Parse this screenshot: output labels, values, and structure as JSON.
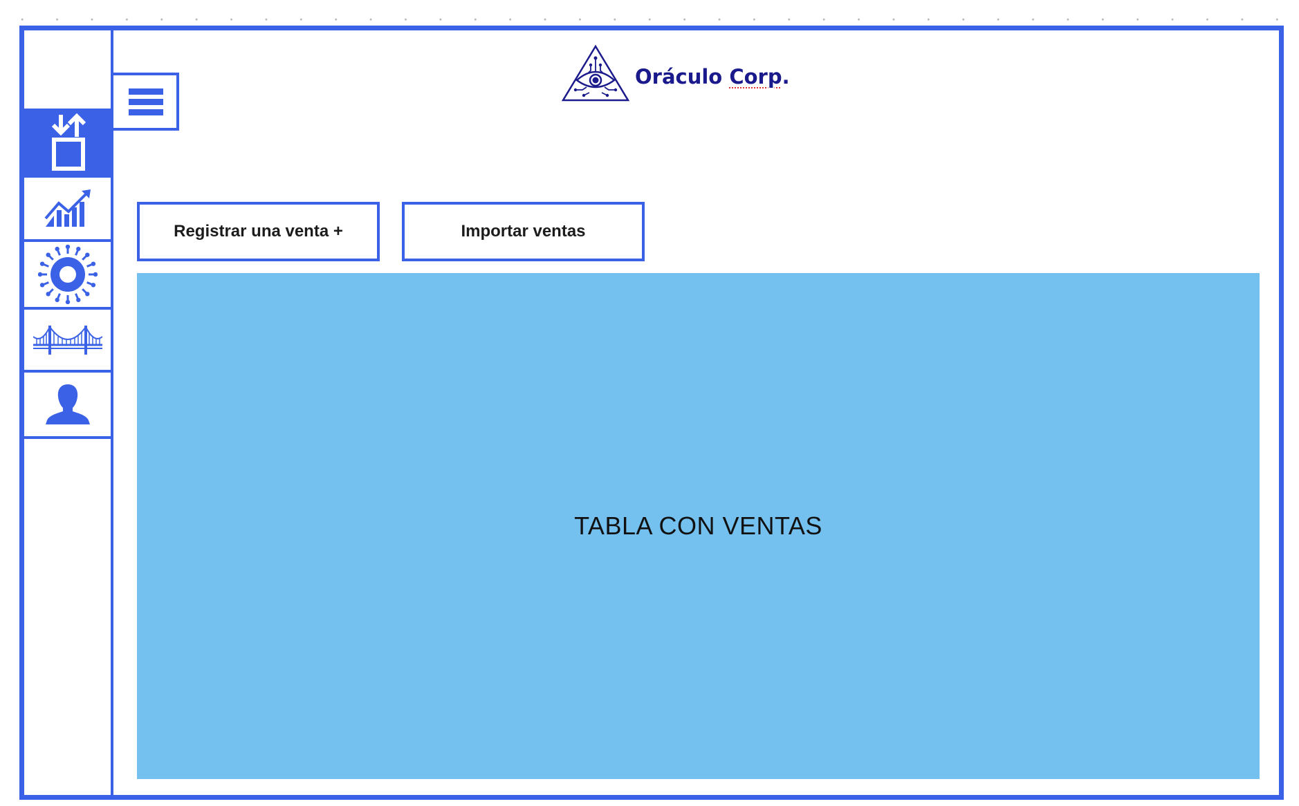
{
  "brand": {
    "name_main": "Oráculo ",
    "name_marked": "Corp",
    "name_end": ".",
    "icon": "triangle-eye-logo-icon",
    "color": "#1a1a8c"
  },
  "colors": {
    "accent": "#3b62e6",
    "table_fill": "#74c1ef"
  },
  "sidebar": {
    "menu_icon": "hamburger-menu-icon",
    "items": [
      {
        "icon": "transfer-box-icon",
        "active": true
      },
      {
        "icon": "growth-chart-icon",
        "active": false
      },
      {
        "icon": "gear-icon",
        "active": false
      },
      {
        "icon": "bridge-icon",
        "active": false
      },
      {
        "icon": "user-icon",
        "active": false
      }
    ]
  },
  "actions": {
    "register_label": "Registrar una venta +",
    "import_label": "Importar ventas"
  },
  "main": {
    "table_placeholder": "TABLA CON VENTAS"
  }
}
